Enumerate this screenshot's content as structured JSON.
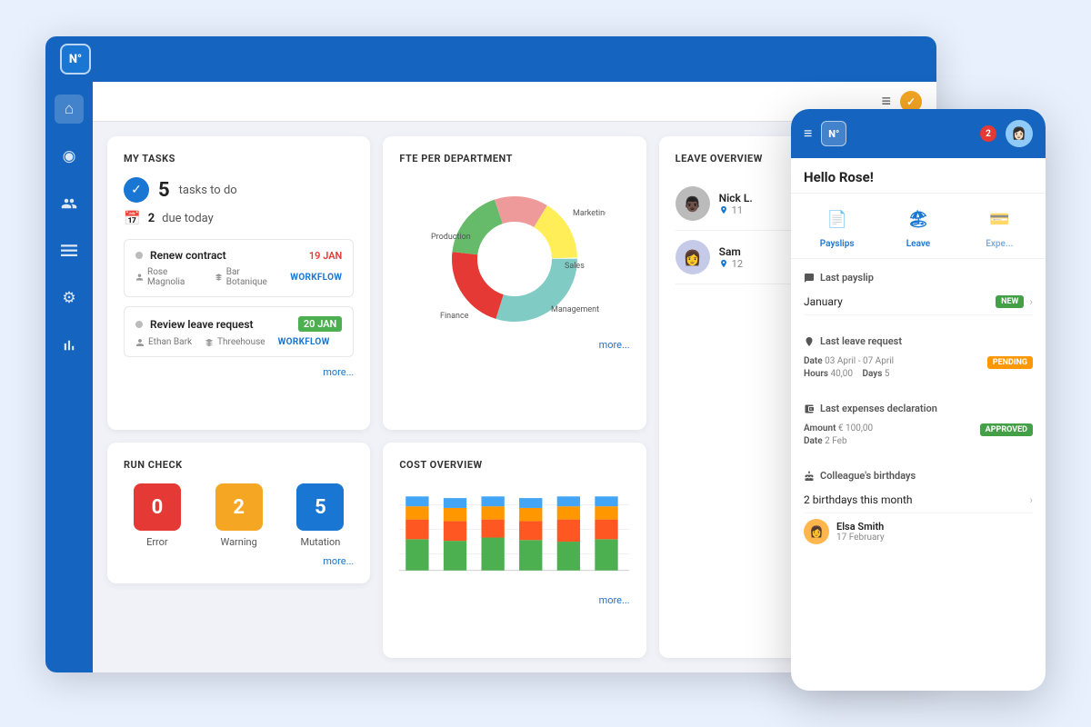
{
  "app": {
    "logo": "N°",
    "notification_icon": "✓",
    "hamburger": "≡"
  },
  "sidebar": {
    "items": [
      {
        "name": "home",
        "icon": "⌂",
        "active": true
      },
      {
        "name": "compass",
        "icon": "◎",
        "active": false
      },
      {
        "name": "people",
        "icon": "👤",
        "active": false
      },
      {
        "name": "list",
        "icon": "☰",
        "active": false
      },
      {
        "name": "settings",
        "icon": "⚙",
        "active": false
      },
      {
        "name": "chart",
        "icon": "📊",
        "active": false
      }
    ]
  },
  "my_tasks": {
    "title": "MY TASKS",
    "tasks_count": "5",
    "tasks_label": "tasks to do",
    "due_count": "2",
    "due_label": "due today",
    "items": [
      {
        "name": "Renew contract",
        "date": "19 JAN",
        "date_style": "red",
        "person": "Rose Magnolia",
        "company": "Bar Botanique",
        "badge": "WORKFLOW"
      },
      {
        "name": "Review leave request",
        "date": "20 JAN",
        "date_style": "green",
        "person": "Ethan Bark",
        "company": "Threehouse",
        "badge": "WORKFLOW"
      }
    ],
    "more": "more..."
  },
  "run_check": {
    "title": "RUN CHECK",
    "items": [
      {
        "label": "Error",
        "value": "0",
        "style": "error"
      },
      {
        "label": "Warning",
        "value": "2",
        "style": "warning"
      },
      {
        "label": "Mutation",
        "value": "5",
        "style": "mutation"
      }
    ],
    "more": "more..."
  },
  "fte": {
    "title": "FTE PER DEPARTMENT",
    "segments": [
      {
        "label": "Marketing",
        "color": "#e53935",
        "value": 22
      },
      {
        "label": "Sales",
        "color": "#66bb6a",
        "value": 18
      },
      {
        "label": "Management",
        "color": "#ef9a9a",
        "value": 14
      },
      {
        "label": "Finance",
        "color": "#ffee58",
        "value": 16
      },
      {
        "label": "Production",
        "color": "#80cbc4",
        "value": 30
      }
    ],
    "more": "more..."
  },
  "cost_overview": {
    "title": "COST OVERVIEW",
    "bars": [
      {
        "green": 38,
        "orange": 28,
        "blue": 16,
        "red": 12
      },
      {
        "green": 36,
        "orange": 25,
        "blue": 18,
        "red": 14
      },
      {
        "green": 40,
        "orange": 26,
        "blue": 14,
        "red": 12
      },
      {
        "green": 37,
        "orange": 27,
        "blue": 15,
        "red": 13
      },
      {
        "green": 35,
        "orange": 30,
        "blue": 17,
        "red": 10
      },
      {
        "green": 38,
        "orange": 24,
        "blue": 16,
        "red": 14
      }
    ],
    "more": "more..."
  },
  "leave_overview": {
    "title": "LEAVE OVERVIEW",
    "people": [
      {
        "name": "Nick L.",
        "detail": "11",
        "icon": "👨🏿"
      },
      {
        "name": "Sam",
        "detail": "12",
        "icon": "👩"
      }
    ]
  },
  "mobile": {
    "logo": "N°",
    "greeting": "Hello Rose!",
    "notification_count": "2",
    "quick_actions": [
      {
        "label": "Payslips",
        "icon": "📄"
      },
      {
        "label": "Leave",
        "icon": "🏖"
      },
      {
        "label": "Expe...",
        "icon": "💳"
      }
    ],
    "last_payslip": {
      "title": "Last payslip",
      "month": "January",
      "badge": "NEW"
    },
    "last_leave": {
      "title": "Last leave request",
      "date_label": "Date",
      "date_value": "03 April - 07 April",
      "hours_label": "Hours",
      "hours_value": "40,00",
      "days_label": "Days",
      "days_value": "5",
      "badge": "PENDING"
    },
    "expenses": {
      "title": "Last expenses declaration",
      "amount_label": "Amount",
      "amount_value": "€ 100,00",
      "date_label": "Date",
      "date_value": "2 Feb",
      "badge": "APPROVED"
    },
    "birthdays": {
      "title": "Colleague's birthdays",
      "count": "2 birthdays this month",
      "people": [
        {
          "name": "Elsa Smith",
          "date": "17 February",
          "icon": "👩"
        }
      ]
    }
  }
}
